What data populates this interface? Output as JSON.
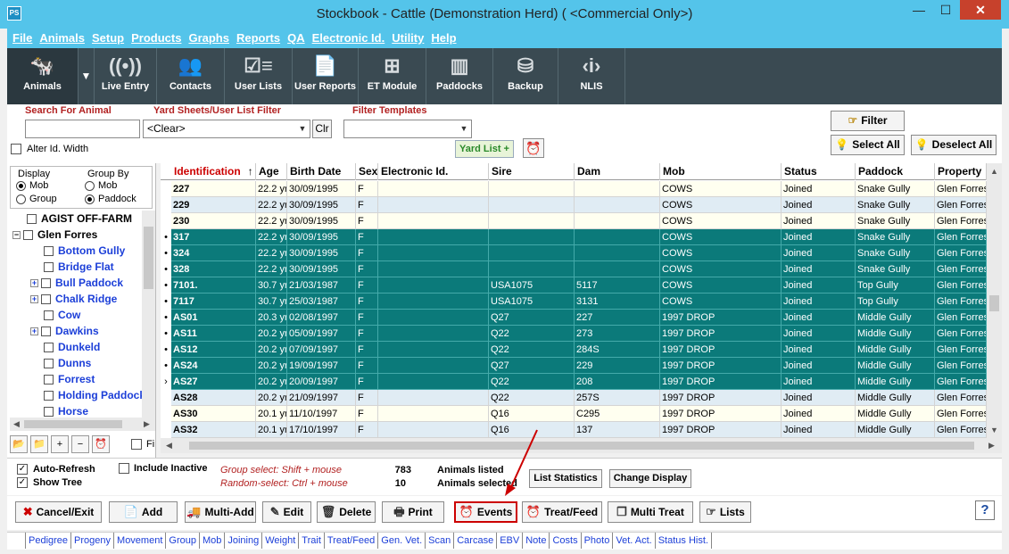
{
  "window": {
    "title": "Stockbook - Cattle (Demonstration Herd) ( <Commercial Only>)",
    "app_icon": "PS",
    "min": "—",
    "max": "☐",
    "close": "✕"
  },
  "menu": [
    "File",
    "Animals",
    "Setup",
    "Products",
    "Graphs",
    "Reports",
    "QA",
    "Electronic Id.",
    "Utility",
    "Help"
  ],
  "toolbar": [
    {
      "label": "Animals",
      "icon": "cow-icon",
      "glyph": "🐄"
    },
    {
      "label": "Live Entry",
      "icon": "broadcast-icon",
      "glyph": "((•))"
    },
    {
      "label": "Contacts",
      "icon": "people-icon",
      "glyph": "👥"
    },
    {
      "label": "User Lists",
      "icon": "checklist-icon",
      "glyph": "☑≡"
    },
    {
      "label": "User Reports",
      "icon": "report-icon",
      "glyph": "📄"
    },
    {
      "label": "ET Module",
      "icon": "hierarchy-icon",
      "glyph": "⊞"
    },
    {
      "label": "Paddocks",
      "icon": "fence-icon",
      "glyph": "▥"
    },
    {
      "label": "Backup",
      "icon": "database-icon",
      "glyph": "⛁"
    },
    {
      "label": "NLIS",
      "icon": "nlis-tag-icon",
      "glyph": "‹i›"
    }
  ],
  "filters": {
    "search_label": "Search For Animal",
    "search_value": "",
    "yard_label": "Yard Sheets/User List Filter",
    "yard_value": "<Clear>",
    "clr": "Clr",
    "templates_label": "Filter Templates",
    "templates_value": "",
    "alter_id": "Alter Id. Width",
    "yard_list": "Yard List +",
    "filter_btn": "Filter",
    "select_all": "Select All",
    "deselect_all": "Deselect All"
  },
  "display": {
    "display_label": "Display",
    "mob": "Mob",
    "group": "Group",
    "groupby_label": "Group By",
    "gb_mob": "Mob",
    "gb_paddock": "Paddock"
  },
  "tree": [
    {
      "label": "AGIST OFF-FARM",
      "level": 0,
      "exp": ""
    },
    {
      "label": "Glen Forres",
      "level": 0,
      "exp": "−"
    },
    {
      "label": "Bottom Gully",
      "level": 1,
      "exp": ""
    },
    {
      "label": "Bridge Flat",
      "level": 1,
      "exp": ""
    },
    {
      "label": "Bull Paddock",
      "level": 1,
      "exp": "+"
    },
    {
      "label": "Chalk Ridge",
      "level": 1,
      "exp": "+"
    },
    {
      "label": "Cow",
      "level": 1,
      "exp": ""
    },
    {
      "label": "Dawkins",
      "level": 1,
      "exp": "+"
    },
    {
      "label": "Dunkeld",
      "level": 1,
      "exp": ""
    },
    {
      "label": "Dunns",
      "level": 1,
      "exp": ""
    },
    {
      "label": "Forrest",
      "level": 1,
      "exp": ""
    },
    {
      "label": "Holding Paddock",
      "level": 1,
      "exp": ""
    },
    {
      "label": "Horse",
      "level": 1,
      "exp": ""
    }
  ],
  "tree_tools": {
    "fi": "Fi"
  },
  "grid": {
    "columns": [
      "Identification",
      "Age",
      "Birth Date",
      "Sex",
      "Electronic Id.",
      "Sire",
      "Dam",
      "Mob",
      "Status",
      "Paddock",
      "Property"
    ],
    "sort_mark": "↑",
    "rows": [
      {
        "mark": "",
        "sel": false,
        "cells": [
          "227",
          "22.2 yr",
          "30/09/1995",
          "F",
          "",
          "",
          "",
          "COWS",
          "Joined",
          "Snake Gully",
          "Glen Forres"
        ]
      },
      {
        "mark": "",
        "sel": false,
        "cells": [
          "229",
          "22.2 yr",
          "30/09/1995",
          "F",
          "",
          "",
          "",
          "COWS",
          "Joined",
          "Snake Gully",
          "Glen Forres"
        ]
      },
      {
        "mark": "",
        "sel": false,
        "cells": [
          "230",
          "22.2 yr",
          "30/09/1995",
          "F",
          "",
          "",
          "",
          "COWS",
          "Joined",
          "Snake Gully",
          "Glen Forres"
        ]
      },
      {
        "mark": "•",
        "sel": true,
        "cells": [
          "317",
          "22.2 yr",
          "30/09/1995",
          "F",
          "",
          "",
          "",
          "COWS",
          "Joined",
          "Snake Gully",
          "Glen Forres"
        ]
      },
      {
        "mark": "•",
        "sel": true,
        "cells": [
          "324",
          "22.2 yr",
          "30/09/1995",
          "F",
          "",
          "",
          "",
          "COWS",
          "Joined",
          "Snake Gully",
          "Glen Forres"
        ]
      },
      {
        "mark": "•",
        "sel": true,
        "cells": [
          "328",
          "22.2 yr",
          "30/09/1995",
          "F",
          "",
          "",
          "",
          "COWS",
          "Joined",
          "Snake Gully",
          "Glen Forres"
        ]
      },
      {
        "mark": "•",
        "sel": true,
        "cells": [
          "7101.",
          "30.7 yr",
          "21/03/1987",
          "F",
          "",
          "USA1075",
          "5117",
          "COWS",
          "Joined",
          "Top Gully",
          "Glen Forres"
        ]
      },
      {
        "mark": "•",
        "sel": true,
        "cells": [
          "7117",
          "30.7 yr",
          "25/03/1987",
          "F",
          "",
          "USA1075",
          "3131",
          "COWS",
          "Joined",
          "Top Gully",
          "Glen Forres"
        ]
      },
      {
        "mark": "•",
        "sel": true,
        "cells": [
          "AS01",
          "20.3 yr",
          "02/08/1997",
          "F",
          "",
          "Q27",
          "227",
          "1997 DROP",
          "Joined",
          "Middle Gully",
          "Glen Forres"
        ]
      },
      {
        "mark": "•",
        "sel": true,
        "cells": [
          "AS11",
          "20.2 yr",
          "05/09/1997",
          "F",
          "",
          "Q22",
          "273",
          "1997 DROP",
          "Joined",
          "Middle Gully",
          "Glen Forres"
        ]
      },
      {
        "mark": "•",
        "sel": true,
        "cells": [
          "AS12",
          "20.2 yr",
          "07/09/1997",
          "F",
          "",
          "Q22",
          "284S",
          "1997 DROP",
          "Joined",
          "Middle Gully",
          "Glen Forres"
        ]
      },
      {
        "mark": "•",
        "sel": true,
        "cells": [
          "AS24",
          "20.2 yr",
          "19/09/1997",
          "F",
          "",
          "Q27",
          "229",
          "1997 DROP",
          "Joined",
          "Middle Gully",
          "Glen Forres"
        ]
      },
      {
        "mark": "›",
        "sel": true,
        "cells": [
          "AS27",
          "20.2 yr",
          "20/09/1997",
          "F",
          "",
          "Q22",
          "208",
          "1997 DROP",
          "Joined",
          "Middle Gully",
          "Glen Forres"
        ]
      },
      {
        "mark": "",
        "sel": false,
        "cells": [
          "AS28",
          "20.2 yr",
          "21/09/1997",
          "F",
          "",
          "Q22",
          "257S",
          "1997 DROP",
          "Joined",
          "Middle Gully",
          "Glen Forres"
        ]
      },
      {
        "mark": "",
        "sel": false,
        "cells": [
          "AS30",
          "20.1 yr",
          "11/10/1997",
          "F",
          "",
          "Q16",
          "C295",
          "1997 DROP",
          "Joined",
          "Middle Gully",
          "Glen Forres"
        ]
      },
      {
        "mark": "",
        "sel": false,
        "cells": [
          "AS32",
          "20.1 yr",
          "17/10/1997",
          "F",
          "",
          "Q16",
          "137",
          "1997 DROP",
          "Joined",
          "Middle Gully",
          "Glen Forres"
        ]
      }
    ]
  },
  "status": {
    "auto_refresh": "Auto-Refresh",
    "show_tree": "Show Tree",
    "include_inactive": "Include Inactive",
    "hint1": "Group select: Shift + mouse",
    "hint2": "Random-select: Ctrl + mouse",
    "listed_count": "783",
    "listed_label": "Animals listed",
    "selected_count": "10",
    "selected_label": "Animals selected",
    "list_stats": "List Statistics",
    "change_display": "Change Display"
  },
  "actions": [
    {
      "label": "Cancel/Exit",
      "glyph": "✖",
      "color": "#c00"
    },
    {
      "label": "Add",
      "glyph": "📄",
      "color": "#333"
    },
    {
      "label": "Multi-Add",
      "glyph": "🚚",
      "color": "#333"
    },
    {
      "label": "Edit",
      "glyph": "✎",
      "color": "#333"
    },
    {
      "label": "Delete",
      "glyph": "🗑",
      "color": "#333"
    },
    {
      "label": "Print",
      "glyph": "🖶",
      "color": "#333"
    },
    {
      "label": "Events",
      "glyph": "⏰",
      "color": "#c00"
    },
    {
      "label": "Treat/Feed",
      "glyph": "⏰",
      "color": "#c00"
    },
    {
      "label": "Multi Treat",
      "glyph": "❐",
      "color": "#333"
    },
    {
      "label": "Lists",
      "glyph": "☞",
      "color": "#333"
    }
  ],
  "help": "?",
  "links": [
    "Pedigree",
    "Progeny",
    "Movement",
    "Group",
    "Mob",
    "Joining",
    "Weight",
    "Trait",
    "Treat/Feed",
    "Gen. Vet.",
    "Scan",
    "Carcase",
    "EBV",
    "Note",
    "Costs",
    "Photo",
    "Vet. Act.",
    "Status Hist."
  ],
  "colors": {
    "titlebar": "#54c4ea",
    "toolbar": "#3a4a52",
    "selected_row": "#0b7a7a",
    "highlight": "#c00000"
  }
}
